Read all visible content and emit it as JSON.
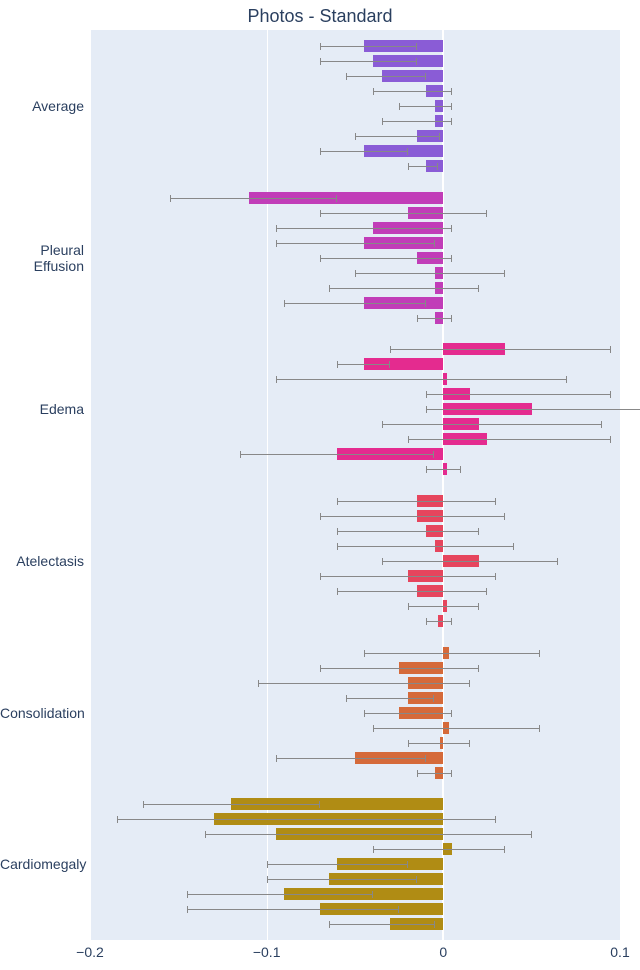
{
  "title": "Photos - Standard",
  "x_axis": {
    "min": -0.2,
    "max": 0.1,
    "ticks": [
      -0.2,
      -0.1,
      0,
      0.1
    ]
  },
  "categories": [
    "Cardiomegaly",
    "Consolidation",
    "Atelectasis",
    "Edema",
    "Pleural Effusion",
    "Average"
  ],
  "colors": {
    "Average": "#8a5cd6",
    "Pleural Effusion": "#c13db8",
    "Edema": "#e42b8f",
    "Atelectasis": "#e6455d",
    "Consolidation": "#d56a3a",
    "Cardiomegaly": "#b08c14"
  },
  "chart_data": {
    "type": "bar",
    "orientation": "horizontal",
    "title": "Photos - Standard",
    "xlabel": "",
    "ylabel": "",
    "xlim": [
      -0.2,
      0.1
    ],
    "categories": [
      "Cardiomegaly",
      "Consolidation",
      "Atelectasis",
      "Edema",
      "Pleural Effusion",
      "Average"
    ],
    "groups": {
      "Cardiomegaly": [
        {
          "value": -0.12,
          "err_low": -0.17,
          "err_high": -0.07
        },
        {
          "value": -0.13,
          "err_low": -0.185,
          "err_high": 0.03
        },
        {
          "value": -0.095,
          "err_low": -0.135,
          "err_high": 0.05
        },
        {
          "value": 0.005,
          "err_low": -0.04,
          "err_high": 0.035
        },
        {
          "value": -0.06,
          "err_low": -0.1,
          "err_high": -0.02
        },
        {
          "value": -0.065,
          "err_low": -0.1,
          "err_high": -0.015
        },
        {
          "value": -0.09,
          "err_low": -0.145,
          "err_high": -0.04
        },
        {
          "value": -0.07,
          "err_low": -0.145,
          "err_high": -0.025
        },
        {
          "value": -0.03,
          "err_low": -0.065,
          "err_high": -0.005
        }
      ],
      "Consolidation": [
        {
          "value": 0.003,
          "err_low": -0.045,
          "err_high": 0.055
        },
        {
          "value": -0.025,
          "err_low": -0.07,
          "err_high": 0.02
        },
        {
          "value": -0.02,
          "err_low": -0.105,
          "err_high": 0.015
        },
        {
          "value": -0.02,
          "err_low": -0.055,
          "err_high": -0.005
        },
        {
          "value": -0.025,
          "err_low": -0.045,
          "err_high": 0.005
        },
        {
          "value": 0.003,
          "err_low": -0.04,
          "err_high": 0.055
        },
        {
          "value": -0.002,
          "err_low": -0.02,
          "err_high": 0.015
        },
        {
          "value": -0.05,
          "err_low": -0.095,
          "err_high": -0.01
        },
        {
          "value": -0.005,
          "err_low": -0.015,
          "err_high": 0.005
        }
      ],
      "Atelectasis": [
        {
          "value": -0.015,
          "err_low": -0.06,
          "err_high": 0.03
        },
        {
          "value": -0.015,
          "err_low": -0.07,
          "err_high": 0.035
        },
        {
          "value": -0.01,
          "err_low": -0.06,
          "err_high": 0.02
        },
        {
          "value": -0.005,
          "err_low": -0.06,
          "err_high": 0.04
        },
        {
          "value": 0.02,
          "err_low": -0.035,
          "err_high": 0.065
        },
        {
          "value": -0.02,
          "err_low": -0.07,
          "err_high": 0.03
        },
        {
          "value": -0.015,
          "err_low": -0.06,
          "err_high": 0.025
        },
        {
          "value": 0.002,
          "err_low": -0.02,
          "err_high": 0.02
        },
        {
          "value": -0.003,
          "err_low": -0.01,
          "err_high": 0.005
        }
      ],
      "Edema": [
        {
          "value": 0.035,
          "err_low": -0.03,
          "err_high": 0.095
        },
        {
          "value": -0.045,
          "err_low": -0.06,
          "err_high": -0.03
        },
        {
          "value": 0.002,
          "err_low": -0.095,
          "err_high": 0.07
        },
        {
          "value": 0.015,
          "err_low": -0.01,
          "err_high": 0.095
        },
        {
          "value": 0.05,
          "err_low": -0.01,
          "err_high": 0.12
        },
        {
          "value": 0.02,
          "err_low": -0.035,
          "err_high": 0.09
        },
        {
          "value": 0.025,
          "err_low": -0.02,
          "err_high": 0.095
        },
        {
          "value": -0.06,
          "err_low": -0.115,
          "err_high": -0.005
        },
        {
          "value": 0.002,
          "err_low": -0.01,
          "err_high": 0.01
        }
      ],
      "Pleural Effusion": [
        {
          "value": -0.11,
          "err_low": -0.155,
          "err_high": -0.06
        },
        {
          "value": -0.02,
          "err_low": -0.07,
          "err_high": 0.025
        },
        {
          "value": -0.04,
          "err_low": -0.095,
          "err_high": 0.005
        },
        {
          "value": -0.045,
          "err_low": -0.095,
          "err_high": -0.005
        },
        {
          "value": -0.015,
          "err_low": -0.07,
          "err_high": 0.005
        },
        {
          "value": -0.005,
          "err_low": -0.05,
          "err_high": 0.035
        },
        {
          "value": -0.005,
          "err_low": -0.065,
          "err_high": 0.02
        },
        {
          "value": -0.045,
          "err_low": -0.09,
          "err_high": -0.01
        },
        {
          "value": -0.005,
          "err_low": -0.015,
          "err_high": 0.005
        }
      ],
      "Average": [
        {
          "value": -0.045,
          "err_low": -0.07,
          "err_high": -0.015
        },
        {
          "value": -0.04,
          "err_low": -0.07,
          "err_high": -0.015
        },
        {
          "value": -0.035,
          "err_low": -0.055,
          "err_high": -0.01
        },
        {
          "value": -0.01,
          "err_low": -0.04,
          "err_high": 0.005
        },
        {
          "value": -0.005,
          "err_low": -0.025,
          "err_high": 0.005
        },
        {
          "value": -0.005,
          "err_low": -0.035,
          "err_high": 0.005
        },
        {
          "value": -0.015,
          "err_low": -0.05,
          "err_high": -0.002
        },
        {
          "value": -0.045,
          "err_low": -0.07,
          "err_high": -0.02
        },
        {
          "value": -0.01,
          "err_low": -0.02,
          "err_high": -0.003
        }
      ]
    }
  }
}
